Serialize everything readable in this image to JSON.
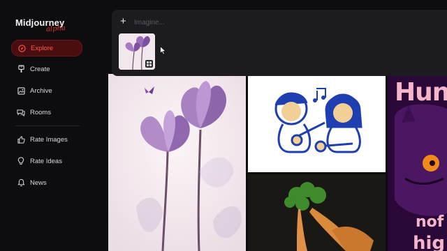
{
  "sidebar": {
    "logo": {
      "title": "Midjourney",
      "badge": "alpha"
    },
    "items": [
      {
        "label": "Explore",
        "icon": "compass-icon",
        "active": true
      },
      {
        "label": "Create",
        "icon": "brush-icon"
      },
      {
        "label": "Archive",
        "icon": "image-icon"
      },
      {
        "label": "Rooms",
        "icon": "chat-icon"
      },
      {
        "label": "Rate Images",
        "icon": "thumbs-up-icon"
      },
      {
        "label": "Rate Ideas",
        "icon": "lightbulb-icon"
      },
      {
        "label": "News",
        "icon": "bell-icon"
      }
    ]
  },
  "prompt": {
    "placeholder": "Imagine..."
  },
  "colors": {
    "accent": "#ff5a4a",
    "active_bg": "#4a0e10",
    "panel": "#1c1c20",
    "background": "#0d0d10"
  },
  "gallery": {
    "cards": [
      {
        "subject": "purple translucent tulips with butterfly"
      },
      {
        "subject": "two cartoon kids playing ukulele with music notes"
      },
      {
        "subject": "carrots with leafy tops on dark background"
      },
      {
        "subject": "purple cat poster with pink lettering",
        "text_top": "Hun",
        "text_bottom_1": "nof",
        "text_bottom_2": "hig"
      }
    ]
  }
}
